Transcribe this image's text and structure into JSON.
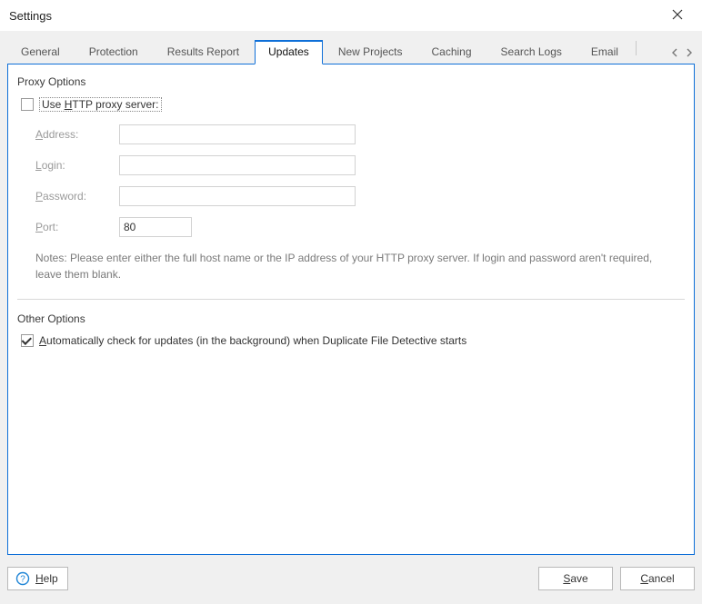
{
  "window": {
    "title": "Settings"
  },
  "tabs": [
    {
      "label": "General",
      "active": false
    },
    {
      "label": "Protection",
      "active": false
    },
    {
      "label": "Results Report",
      "active": false
    },
    {
      "label": "Updates",
      "active": true
    },
    {
      "label": "New Projects",
      "active": false
    },
    {
      "label": "Caching",
      "active": false
    },
    {
      "label": "Search Logs",
      "active": false
    },
    {
      "label": "Email",
      "active": false
    }
  ],
  "proxy": {
    "section_title": "Proxy Options",
    "use_http_checked": false,
    "use_http_prefix": "Use ",
    "use_http_accel": "H",
    "use_http_suffix": "TTP proxy server:",
    "labels": {
      "address_accel": "A",
      "address_rest": "ddress:",
      "login_accel": "L",
      "login_rest": "ogin:",
      "password_accel": "P",
      "password_rest": "assword:",
      "port_accel": "P",
      "port_rest": "ort:"
    },
    "values": {
      "address": "",
      "login": "",
      "password": "",
      "port": "80"
    },
    "notes": "Notes: Please enter either the full host name or the IP address of your HTTP proxy server. If login and password aren't required, leave them blank."
  },
  "other": {
    "section_title": "Other Options",
    "auto_check_checked": true,
    "auto_check_accel": "A",
    "auto_check_rest": "utomatically check for updates (in the background) when Duplicate File Detective starts"
  },
  "footer": {
    "help_accel": "H",
    "help_rest": "elp",
    "save_accel": "S",
    "save_rest": "ave",
    "cancel_accel": "C",
    "cancel_rest": "ancel"
  }
}
